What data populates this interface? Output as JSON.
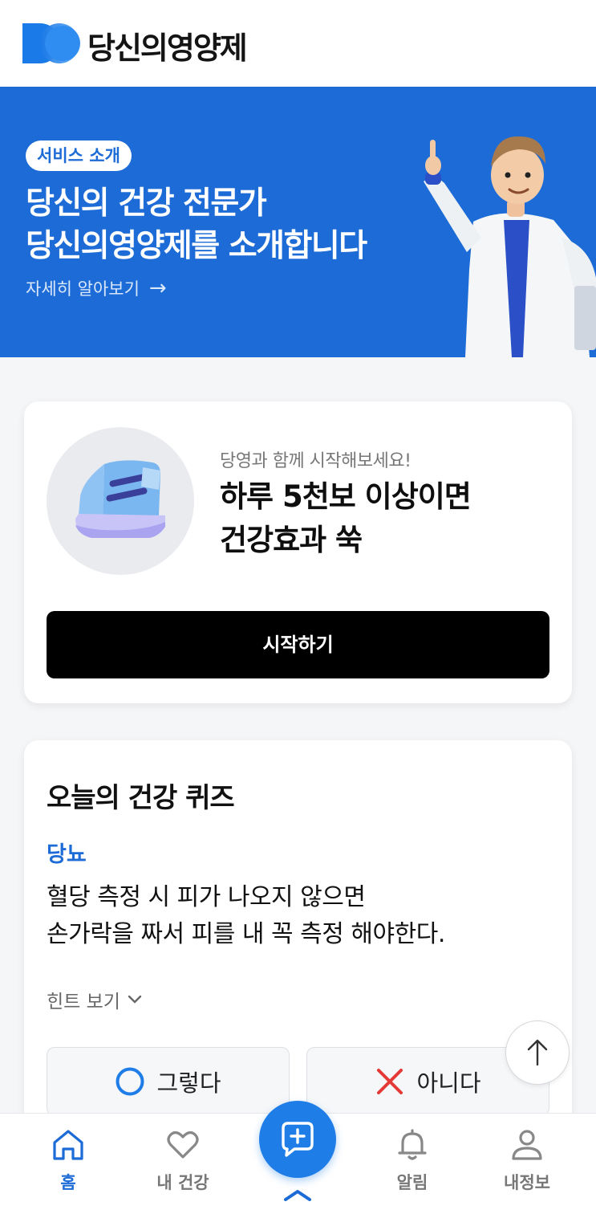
{
  "header": {
    "app_name": "당신의영양제"
  },
  "banner": {
    "badge": "서비스 소개",
    "title_line1": "당신의 건강 전문가",
    "title_line2": "당신의영양제를 소개합니다",
    "link_text": "자세히 알아보기",
    "link_arrow": "→",
    "bg_color": "#1c6bd6"
  },
  "walk_card": {
    "subtitle": "당영과 함께 시작해보세요!",
    "title_line1": "하루 5천보 이상이면",
    "title_line2": "건강효과 쑥",
    "button_label": "시작하기",
    "icon": "sneaker-icon"
  },
  "quiz": {
    "heading": "오늘의 건강 퀴즈",
    "category": "당뇨",
    "question_line1": "혈당 측정 시 피가 나오지 않으면",
    "question_line2": "손가락을 짜서 피를 내 꼭 측정 해야한다.",
    "hint_label": "힌트 보기",
    "yes_label": "그렇다",
    "no_label": "아니다",
    "yes_color": "#1f7de8",
    "no_color": "#e53935"
  },
  "nav": {
    "home": "홈",
    "health": "내 건강",
    "alarm": "알림",
    "my": "내정보",
    "active_color": "#1c6bd6",
    "inactive_color": "#777777"
  }
}
